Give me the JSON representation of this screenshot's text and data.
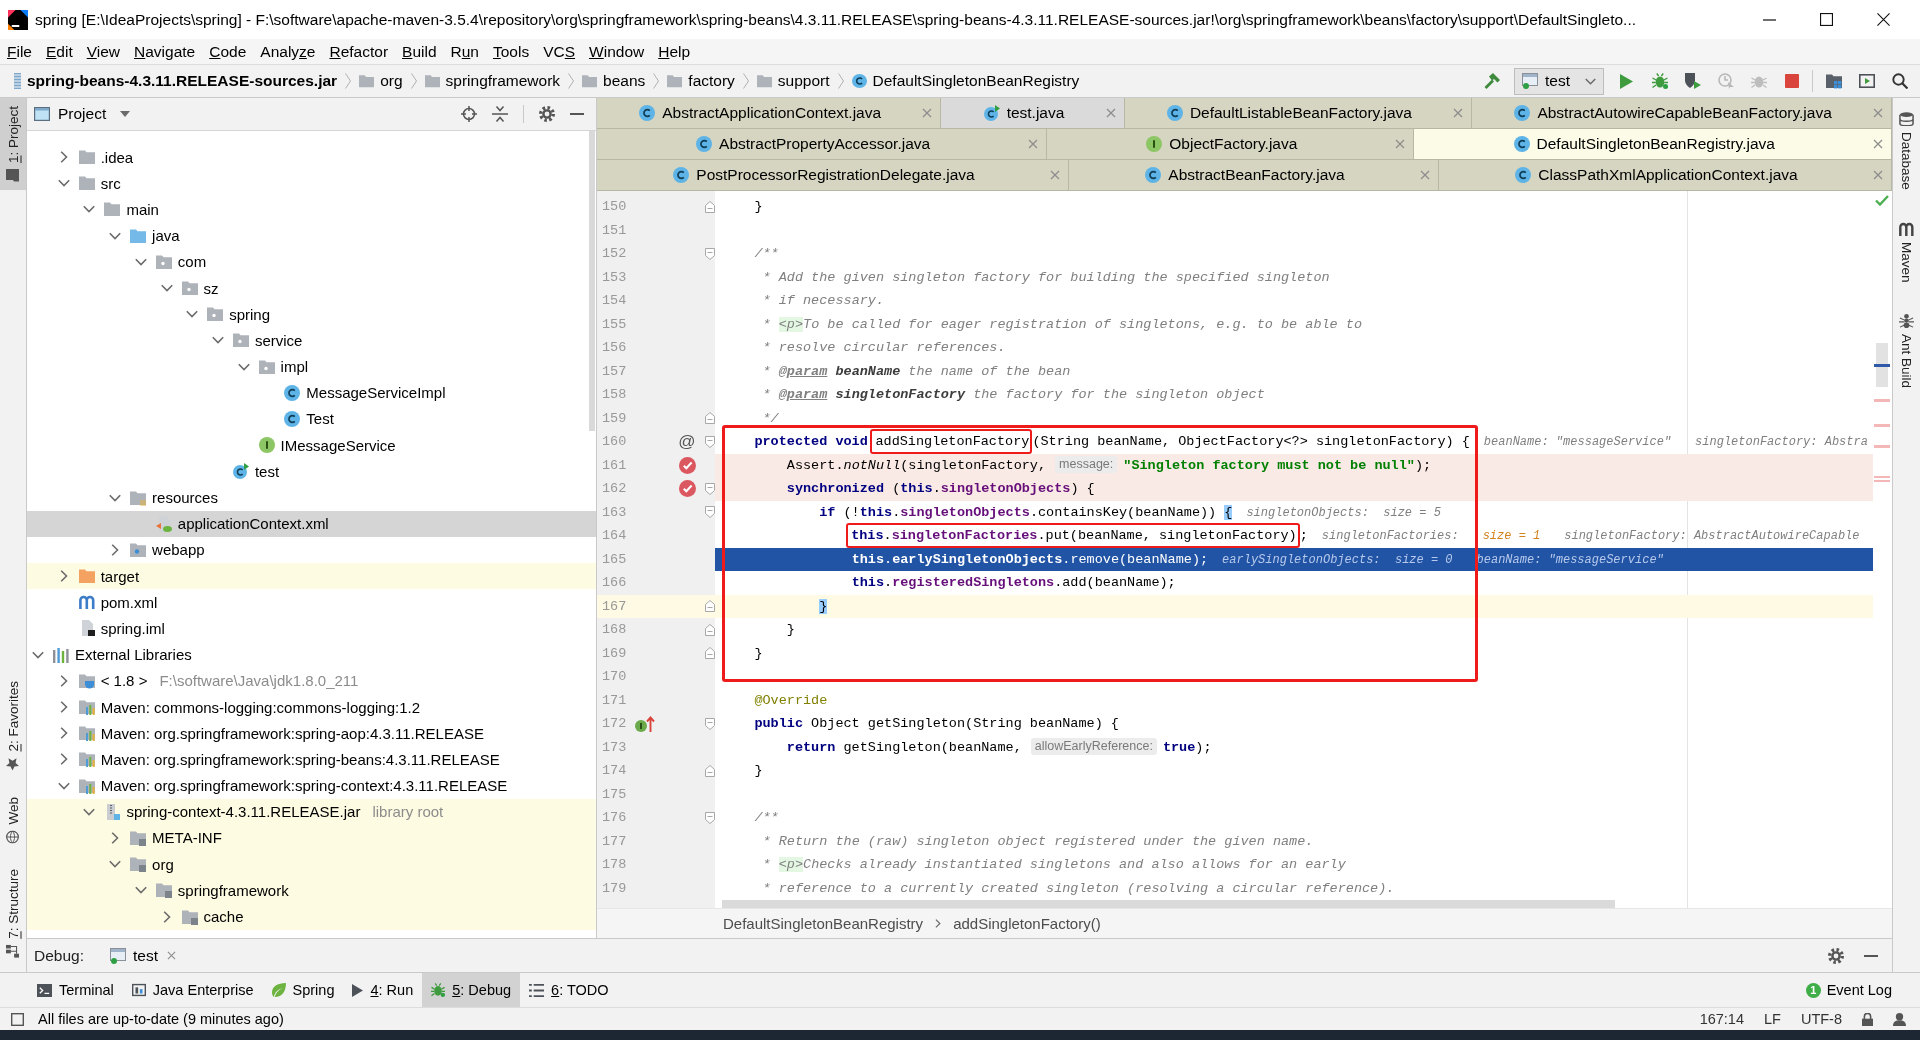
{
  "window": {
    "title": "spring [E:\\IdeaProjects\\spring] - F:\\software\\apache-maven-3.5.4\\repository\\org\\springframework\\spring-beans\\4.3.11.RELEASE\\spring-beans-4.3.11.RELEASE-sources.jar!\\org\\springframework\\beans\\factory\\support\\DefaultSingleto..."
  },
  "menu": [
    {
      "key": "F",
      "after": "ile"
    },
    {
      "key": "E",
      "after": "dit"
    },
    {
      "key": "V",
      "after": "iew"
    },
    {
      "key": "N",
      "after": "avigate"
    },
    {
      "key": "C",
      "after": "ode"
    },
    {
      "before": "Analy",
      "key": "z",
      "after": "e"
    },
    {
      "key": "R",
      "after": "efactor"
    },
    {
      "key": "B",
      "after": "uild"
    },
    {
      "before": "R",
      "key": "u",
      "after": "n"
    },
    {
      "key": "T",
      "after": "ools"
    },
    {
      "before": "VC",
      "key": "S"
    },
    {
      "key": "W",
      "after": "indow"
    },
    {
      "key": "H",
      "after": "elp"
    }
  ],
  "nav_bar": {
    "path": [
      {
        "kind": "jar",
        "label": "spring-beans-4.3.11.RELEASE-sources.jar"
      },
      {
        "kind": "package",
        "label": "org"
      },
      {
        "kind": "package",
        "label": "springframework"
      },
      {
        "kind": "package",
        "label": "beans"
      },
      {
        "kind": "package",
        "label": "factory"
      },
      {
        "kind": "package",
        "label": "support"
      },
      {
        "kind": "class",
        "label": "DefaultSingletonBeanRegistry"
      }
    ],
    "tool_groups": [
      [
        {
          "kind": "build",
          "disabled": false
        },
        {
          "kind": "run-config",
          "label": "test"
        },
        {
          "kind": "run",
          "disabled": false
        },
        {
          "kind": "debug",
          "disabled": false
        },
        {
          "kind": "coverage",
          "disabled": false
        },
        {
          "kind": "profile",
          "disabled": true
        },
        {
          "kind": "attach",
          "disabled": true
        },
        {
          "kind": "stop",
          "disabled": false
        }
      ],
      [
        {
          "kind": "project-structure",
          "disabled": false
        },
        {
          "kind": "console",
          "disabled": false
        },
        {
          "kind": "search",
          "disabled": false
        }
      ]
    ]
  },
  "left_strip": {
    "top": [
      {
        "kind": "project",
        "key": "1",
        "after": ": Project",
        "selected": true
      }
    ],
    "bottom": [
      {
        "kind": "favorites",
        "key": "2",
        "after": ": Favorites",
        "selected": false
      },
      {
        "kind": "web",
        "label": "Web",
        "selected": false
      },
      {
        "kind": "structure",
        "key": "7",
        "after": ": Structure",
        "selected": false
      }
    ]
  },
  "right_strip": [
    {
      "kind": "database",
      "label": "Database"
    },
    {
      "kind": "maven",
      "label": "Maven"
    },
    {
      "kind": "ant",
      "label": "Ant Build"
    }
  ],
  "project_panel": {
    "title": "Project",
    "tree": [
      {
        "children": [
          {
            "kind": "folder",
            "label": ".idea",
            "expanded": false,
            "selected": false,
            "tinted": false
          },
          {
            "kind": "folder",
            "label": "src",
            "expanded": true,
            "selected": false,
            "tinted": false,
            "children": [
              {
                "kind": "folder",
                "label": "main",
                "expanded": true,
                "selected": false,
                "tinted": false,
                "children": [
                  {
                    "kind": "source",
                    "label": "java",
                    "expanded": true,
                    "selected": false,
                    "tinted": false,
                    "children": [
                      {
                        "kind": "package",
                        "label": "com",
                        "expanded": true,
                        "selected": false,
                        "tinted": false,
                        "children": [
                          {
                            "kind": "package",
                            "label": "sz",
                            "expanded": true,
                            "selected": false,
                            "tinted": false,
                            "children": [
                              {
                                "kind": "package",
                                "label": "spring",
                                "expanded": true,
                                "selected": false,
                                "tinted": false,
                                "children": [
                                  {
                                    "kind": "package",
                                    "label": "service",
                                    "expanded": true,
                                    "selected": false,
                                    "tinted": false,
                                    "children": [
                                      {
                                        "kind": "package",
                                        "label": "impl",
                                        "expanded": true,
                                        "selected": false,
                                        "tinted": false,
                                        "children": [
                                          {
                                            "kind": "class",
                                            "label": "MessageServiceImpl",
                                            "selected": false,
                                            "tinted": false
                                          },
                                          {
                                            "kind": "class",
                                            "label": "Test",
                                            "selected": false,
                                            "tinted": false
                                          }
                                        ]
                                      },
                                      {
                                        "kind": "interface",
                                        "label": "IMessageService",
                                        "selected": false,
                                        "tinted": false
                                      }
                                    ]
                                  },
                                  {
                                    "kind": "run-class",
                                    "label": "test",
                                    "selected": false,
                                    "tinted": false
                                  }
                                ]
                              }
                            ]
                          }
                        ]
                      }
                    ]
                  },
                  {
                    "kind": "resources",
                    "label": "resources",
                    "expanded": true,
                    "selected": false,
                    "tinted": false,
                    "children": [
                      {
                        "kind": "xml",
                        "label": "applicationContext.xml",
                        "selected": true,
                        "tinted": false
                      }
                    ]
                  },
                  {
                    "kind": "web",
                    "label": "webapp",
                    "expanded": false,
                    "selected": false,
                    "tinted": false
                  }
                ]
              }
            ]
          },
          {
            "kind": "excluded",
            "label": "target",
            "expanded": false,
            "selected": false,
            "tinted": true
          },
          {
            "kind": "pom",
            "label": "pom.xml",
            "selected": false,
            "tinted": false
          },
          {
            "kind": "iml",
            "label": "spring.iml",
            "selected": false,
            "tinted": false
          }
        ]
      },
      {
        "kind": "libraries",
        "label": "External Libraries",
        "expanded": true,
        "selected": false,
        "tinted": false,
        "children": [
          {
            "kind": "jdk",
            "label": "< 1.8 >",
            "note": "F:\\software\\Java\\jdk1.8.0_211",
            "expanded": false,
            "selected": false,
            "tinted": false
          },
          {
            "kind": "library",
            "label": "Maven: commons-logging:commons-logging:1.2",
            "expanded": false,
            "selected": false,
            "tinted": false
          },
          {
            "kind": "library",
            "label": "Maven: org.springframework:spring-aop:4.3.11.RELEASE",
            "expanded": false,
            "selected": false,
            "tinted": false
          },
          {
            "kind": "library",
            "label": "Maven: org.springframework:spring-beans:4.3.11.RELEASE",
            "expanded": false,
            "selected": false,
            "tinted": false
          },
          {
            "kind": "library",
            "label": "Maven: org.springframework:spring-context:4.3.11.RELEASE",
            "expanded": true,
            "selected": false,
            "tinted": false,
            "children": [
              {
                "kind": "jar",
                "label": "spring-context-4.3.11.RELEASE.jar",
                "note": "library root",
                "expanded": true,
                "selected": false,
                "tinted": true,
                "children": [
                  {
                    "kind": "jar-folder",
                    "label": "META-INF",
                    "expanded": false,
                    "selected": false,
                    "tinted": true
                  },
                  {
                    "kind": "jar-folder",
                    "label": "org",
                    "expanded": true,
                    "selected": false,
                    "tinted": true,
                    "children": [
                      {
                        "kind": "jar-folder",
                        "label": "springframework",
                        "expanded": true,
                        "selected": false,
                        "tinted": true,
                        "children": [
                          {
                            "kind": "jar-folder",
                            "label": "cache",
                            "expanded": false,
                            "selected": false,
                            "tinted": true
                          }
                        ]
                      }
                    ]
                  }
                ]
              }
            ]
          }
        ]
      }
    ]
  },
  "editor": {
    "tab_rows": [
      [
        {
          "kind": "class",
          "label": "AbstractApplicationContext.java",
          "selected": false,
          "library": true
        },
        {
          "kind": "run-class",
          "label": "test.java",
          "selected": false,
          "library": false
        },
        {
          "kind": "class",
          "label": "DefaultListableBeanFactory.java",
          "selected": false,
          "library": true
        },
        {
          "kind": "class",
          "label": "AbstractAutowireCapableBeanFactory.java",
          "selected": false,
          "library": true
        }
      ],
      [
        {
          "kind": "class",
          "label": "AbstractPropertyAccessor.java",
          "selected": false,
          "library": true
        },
        {
          "kind": "interface",
          "label": "ObjectFactory.java",
          "selected": false,
          "library": true
        },
        {
          "kind": "class",
          "label": "DefaultSingletonBeanRegistry.java",
          "selected": true,
          "library": true
        }
      ],
      [
        {
          "kind": "class",
          "label": "PostProcessorRegistrationDelegate.java",
          "selected": false,
          "library": true
        },
        {
          "kind": "class",
          "label": "AbstractBeanFactory.java",
          "selected": false,
          "library": true
        },
        {
          "kind": "class",
          "label": "ClassPathXmlApplicationContext.java",
          "selected": false,
          "library": true
        }
      ]
    ],
    "code_blocks": [
      {
        "boxed": false,
        "lines": [
          {
            "number": "150",
            "fold": {
              "kind": "end"
            },
            "segments": [
              {
                "kind": "plain",
                "text": "    }"
              }
            ]
          },
          {
            "number": "151"
          },
          {
            "number": "152",
            "fold": {
              "kind": "start"
            },
            "segments": [
              {
                "kind": "comment",
                "text": "    /**"
              }
            ]
          },
          {
            "number": "153",
            "segments": [
              {
                "kind": "comment",
                "text": "     * Add the given singleton factory for building the specified singleton"
              }
            ]
          },
          {
            "number": "154",
            "segments": [
              {
                "kind": "comment",
                "text": "     * if necessary."
              }
            ]
          },
          {
            "number": "155",
            "segments": [
              {
                "kind": "comment",
                "text": "     * "
              },
              {
                "kind": "html-tag",
                "text": "<p>"
              },
              {
                "kind": "comment",
                "text": "To be called for eager registration of singletons, e.g. to be able to"
              }
            ]
          },
          {
            "number": "156",
            "segments": [
              {
                "kind": "comment",
                "text": "     * resolve circular references."
              }
            ]
          },
          {
            "number": "157",
            "segments": [
              {
                "kind": "comment",
                "text": "     * "
              },
              {
                "kind": "doc-tag",
                "text": "@param"
              },
              {
                "kind": "doc-param",
                "text": " beanName"
              },
              {
                "kind": "comment",
                "text": " the name of the bean"
              }
            ]
          },
          {
            "number": "158",
            "segments": [
              {
                "kind": "comment",
                "text": "     * "
              },
              {
                "kind": "doc-tag",
                "text": "@param"
              },
              {
                "kind": "doc-param",
                "text": " singletonFactory"
              },
              {
                "kind": "comment",
                "text": " the factory for the singleton object"
              }
            ]
          },
          {
            "number": "159",
            "fold": {
              "kind": "end"
            },
            "segments": [
              {
                "kind": "comment",
                "text": "     */"
              }
            ]
          }
        ]
      },
      {
        "boxed": true,
        "lines": [
          {
            "number": "160",
            "fold": {
              "kind": "start"
            },
            "marker": {
              "kind": "symbol",
              "text": "@"
            },
            "segments": [
              {
                "kind": "keyword",
                "text": "    protected void "
              },
              {
                "kind": "boxed",
                "segments": [
                  {
                    "kind": "plain",
                    "text": "addSingletonFactory"
                  }
                ]
              },
              {
                "kind": "plain",
                "text": "(String beanName, ObjectFactory<?> singletonFactory) {"
              },
              {
                "kind": "debug",
                "text": "beanName: \"messageService\""
              },
              {
                "kind": "debug",
                "text": "singletonFactory: Abstra"
              }
            ]
          },
          {
            "number": "161",
            "marker": {
              "kind": "breakpoint"
            },
            "highlight": {
              "kind": "breakpoint"
            },
            "segments": [
              {
                "kind": "plain",
                "text": "        Assert."
              },
              {
                "kind": "static",
                "text": "notNull"
              },
              {
                "kind": "plain",
                "text": "(singletonFactory,"
              },
              {
                "kind": "hint",
                "text": "message:"
              },
              {
                "kind": "string",
                "text": "\"Singleton factory must not be null\""
              },
              {
                "kind": "plain",
                "text": ");"
              }
            ]
          },
          {
            "number": "162",
            "fold": {
              "kind": "start"
            },
            "marker": {
              "kind": "breakpoint"
            },
            "highlight": {
              "kind": "breakpoint"
            },
            "segments": [
              {
                "kind": "keyword",
                "text": "        synchronized"
              },
              {
                "kind": "plain",
                "text": " ("
              },
              {
                "kind": "keyword",
                "text": "this"
              },
              {
                "kind": "plain",
                "text": "."
              },
              {
                "kind": "field",
                "text": "singletonObjects"
              },
              {
                "kind": "plain",
                "text": ") {"
              }
            ]
          },
          {
            "number": "163",
            "fold": {
              "kind": "start"
            },
            "segments": [
              {
                "kind": "keyword",
                "text": "            if"
              },
              {
                "kind": "plain",
                "text": " (!"
              },
              {
                "kind": "keyword",
                "text": "this"
              },
              {
                "kind": "plain",
                "text": "."
              },
              {
                "kind": "field",
                "text": "singletonObjects"
              },
              {
                "kind": "plain",
                "text": ".containsKey(beanName)) "
              },
              {
                "kind": "brace-match",
                "text": "{"
              },
              {
                "kind": "debug",
                "text": "singletonObjects:  size = 5"
              }
            ]
          },
          {
            "number": "164",
            "segments": [
              {
                "kind": "boxed",
                "segments": [
                  {
                    "kind": "keyword",
                    "text": "                this"
                  },
                  {
                    "kind": "plain",
                    "text": "."
                  },
                  {
                    "kind": "field",
                    "text": "singletonFactories"
                  },
                  {
                    "kind": "plain",
                    "text": ".put(beanName, singletonFactory)"
                  }
                ]
              },
              {
                "kind": "plain",
                "text": ";"
              },
              {
                "kind": "debug",
                "text": "singletonFactories:"
              },
              {
                "kind": "debug-changed",
                "text": "size = 1"
              },
              {
                "kind": "debug",
                "text": "singletonFactory: AbstractAutowireCapable"
              }
            ]
          },
          {
            "number": "165",
            "highlight": {
              "kind": "execution"
            },
            "segments": [
              {
                "kind": "keyword",
                "text": "                this"
              },
              {
                "kind": "plain",
                "text": "."
              },
              {
                "kind": "field",
                "text": "earlySingletonObjects"
              },
              {
                "kind": "plain",
                "text": ".remove(beanName);"
              },
              {
                "kind": "debug",
                "text": "earlySingletonObjects:  size = 0"
              },
              {
                "kind": "debug",
                "text": "beanName: \"messageService\""
              }
            ]
          },
          {
            "number": "166",
            "segments": [
              {
                "kind": "keyword",
                "text": "                this"
              },
              {
                "kind": "plain",
                "text": "."
              },
              {
                "kind": "field",
                "text": "registeredSingletons"
              },
              {
                "kind": "plain",
                "text": ".add(beanName);"
              }
            ]
          },
          {
            "number": "167",
            "fold": {
              "kind": "end"
            },
            "highlight": {
              "kind": "caret"
            },
            "segments": [
              {
                "kind": "brace-match",
                "text": "            }"
              }
            ]
          },
          {
            "number": "168",
            "fold": {
              "kind": "end"
            },
            "segments": [
              {
                "kind": "plain",
                "text": "        }"
              }
            ]
          },
          {
            "number": "169",
            "fold": {
              "kind": "end"
            },
            "segments": [
              {
                "kind": "plain",
                "text": "    }"
              }
            ]
          }
        ]
      },
      {
        "boxed": false,
        "lines": [
          {
            "number": "170"
          },
          {
            "number": "171",
            "segments": [
              {
                "kind": "annotation",
                "text": "    @Override"
              }
            ]
          },
          {
            "number": "172",
            "fold": {
              "kind": "start"
            },
            "marker": {
              "kind": "implements"
            },
            "segments": [
              {
                "kind": "keyword",
                "text": "    public"
              },
              {
                "kind": "plain",
                "text": " Object getSingleton(String beanName) {"
              }
            ]
          },
          {
            "number": "173",
            "segments": [
              {
                "kind": "keyword",
                "text": "        return"
              },
              {
                "kind": "plain",
                "text": " getSingleton(beanName,"
              },
              {
                "kind": "hint",
                "text": "allowEarlyReference:"
              },
              {
                "kind": "keyword",
                "text": "true"
              },
              {
                "kind": "plain",
                "text": ");"
              }
            ]
          },
          {
            "number": "174",
            "fold": {
              "kind": "end"
            },
            "segments": [
              {
                "kind": "plain",
                "text": "    }"
              }
            ]
          },
          {
            "number": "175"
          },
          {
            "number": "176",
            "fold": {
              "kind": "start"
            },
            "segments": [
              {
                "kind": "comment",
                "text": "    /**"
              }
            ]
          },
          {
            "number": "177",
            "segments": [
              {
                "kind": "comment",
                "text": "     * Return the (raw) singleton object registered under the given name."
              }
            ]
          },
          {
            "number": "178",
            "segments": [
              {
                "kind": "comment",
                "text": "     * "
              },
              {
                "kind": "html-tag",
                "text": "<p>"
              },
              {
                "kind": "comment",
                "text": "Checks already instantiated singletons and also allows for an early"
              }
            ]
          },
          {
            "number": "179",
            "segments": [
              {
                "kind": "comment",
                "text": "     * reference to a currently created singleton (resolving a circular reference)."
              }
            ]
          }
        ]
      }
    ],
    "breadcrumb": [
      "DefaultSingletonBeanRegistry",
      "addSingletonFactory()"
    ]
  },
  "debug_bar": {
    "title": "Debug:",
    "tabs": [
      {
        "label": "test"
      }
    ]
  },
  "tool_windows": [
    {
      "kind": "terminal",
      "label": "Terminal",
      "selected": false
    },
    {
      "kind": "java-enterprise",
      "label": "Java Enterprise",
      "selected": false
    },
    {
      "kind": "spring",
      "label": "Spring",
      "selected": false
    },
    {
      "kind": "run",
      "key": "4",
      "after": ": Run",
      "selected": false
    },
    {
      "kind": "debug",
      "key": "5",
      "after": ": Debug",
      "selected": true
    },
    {
      "kind": "todo",
      "key": "6",
      "after": ": TODO",
      "selected": false
    }
  ],
  "event_log": {
    "label": "Event Log",
    "count": "1"
  },
  "status_bar": {
    "message": "All files are up-to-date (9 minutes ago)",
    "position": "167:14",
    "line_separator": "LF",
    "encoding": "UTF-8"
  }
}
